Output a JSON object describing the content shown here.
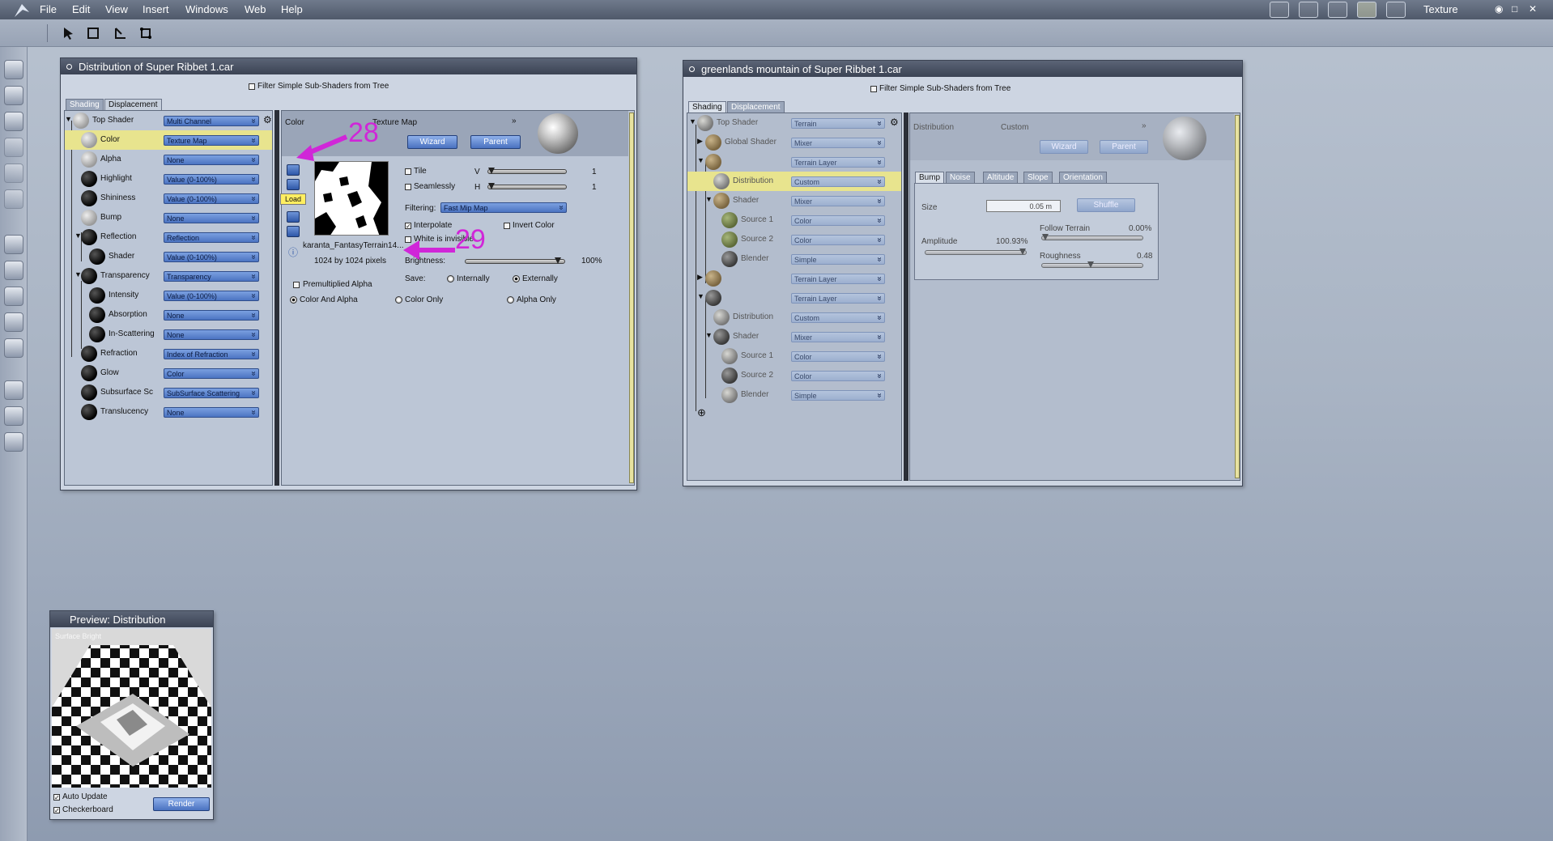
{
  "menubar": {
    "items": [
      "File",
      "Edit",
      "View",
      "Insert",
      "Windows",
      "Web",
      "Help"
    ],
    "room": "Texture"
  },
  "window1": {
    "title": "Distribution of Super Ribbet 1.car",
    "filter_label": "Filter Simple Sub-Shaders from Tree",
    "tabs": [
      "Shading",
      "Displacement"
    ],
    "tree": [
      {
        "label": "Top Shader",
        "value": "Multi Channel"
      },
      {
        "label": "Color",
        "value": "Texture Map"
      },
      {
        "label": "Alpha",
        "value": "None"
      },
      {
        "label": "Highlight",
        "value": "Value (0-100%)"
      },
      {
        "label": "Shininess",
        "value": "Value (0-100%)"
      },
      {
        "label": "Bump",
        "value": "None"
      },
      {
        "label": "Reflection",
        "value": "Reflection"
      },
      {
        "label": "Shader",
        "value": "Value (0-100%)"
      },
      {
        "label": "Transparency",
        "value": "Transparency"
      },
      {
        "label": "Intensity",
        "value": "Value (0-100%)"
      },
      {
        "label": "Absorption",
        "value": "None"
      },
      {
        "label": "In-Scattering",
        "value": "None"
      },
      {
        "label": "Refraction",
        "value": "Index of Refraction"
      },
      {
        "label": "Glow",
        "value": "Color"
      },
      {
        "label": "Subsurface Sc",
        "value": "SubSurface Scattering"
      },
      {
        "label": "Translucency",
        "value": "None"
      }
    ],
    "editor": {
      "channel": "Color",
      "type": "Texture Map",
      "wizard": "Wizard",
      "parent": "Parent",
      "load_tooltip": "Load",
      "tile": "Tile",
      "seamlessly": "Seamlessly",
      "v_label": "V",
      "h_label": "H",
      "v_value": "1",
      "h_value": "1",
      "filtering_label": "Filtering:",
      "filtering_value": "Fast Mip Map",
      "interpolate": "Interpolate",
      "invert_color": "Invert Color",
      "white_invisible": "White is invisible",
      "filename": "karanta_FantasyTerrain14...",
      "size_text": "1024 by 1024 pixels",
      "brightness_label": "Brightness:",
      "brightness_value": "100%",
      "save_label": "Save:",
      "internally": "Internally",
      "externally": "Externally",
      "premultiplied": "Premultiplied Alpha",
      "color_and_alpha": "Color And Alpha",
      "color_only": "Color Only",
      "alpha_only": "Alpha Only"
    }
  },
  "annotations": {
    "a28": "28",
    "a29": "29"
  },
  "window2": {
    "title": "greenlands mountain of Super Ribbet 1.car",
    "filter_label": "Filter Simple Sub-Shaders from Tree",
    "tabs": [
      "Shading",
      "Displacement"
    ],
    "tree": [
      {
        "label": "Top Shader",
        "value": "Terrain"
      },
      {
        "label": "Global Shader",
        "value": "Mixer"
      },
      {
        "label": "",
        "value": "Terrain Layer"
      },
      {
        "label": "Distribution",
        "value": "Custom"
      },
      {
        "label": "Shader",
        "value": "Mixer"
      },
      {
        "label": "Source 1",
        "value": "Color"
      },
      {
        "label": "Source 2",
        "value": "Color"
      },
      {
        "label": "Blender",
        "value": "Simple"
      },
      {
        "label": "",
        "value": "Terrain Layer"
      },
      {
        "label": "",
        "value": "Terrain Layer"
      },
      {
        "label": "Distribution",
        "value": "Custom"
      },
      {
        "label": "Shader",
        "value": "Mixer"
      },
      {
        "label": "Source 1",
        "value": "Color"
      },
      {
        "label": "Source 2",
        "value": "Color"
      },
      {
        "label": "Blender",
        "value": "Simple"
      }
    ],
    "editor": {
      "channel": "Distribution",
      "type": "Custom",
      "wizard": "Wizard",
      "parent": "Parent",
      "subtabs": [
        "Bump",
        "Noise",
        "Altitude",
        "Slope",
        "Orientation"
      ],
      "size_label": "Size",
      "size_value": "0.05 m",
      "shuffle": "Shuffle",
      "amplitude_label": "Amplitude",
      "amplitude_value": "100.93%",
      "amplitude": 1.0,
      "follow_label": "Follow Terrain",
      "follow_value": "0.00%",
      "follow": 0.0,
      "roughness_label": "Roughness",
      "roughness_value": "0.48",
      "roughness": 0.48
    }
  },
  "preview": {
    "title": "Preview: Distribution",
    "overlay": "Surface Bright",
    "auto_update": "Auto Update",
    "checkerboard": "Checkerboard",
    "render": "Render"
  }
}
